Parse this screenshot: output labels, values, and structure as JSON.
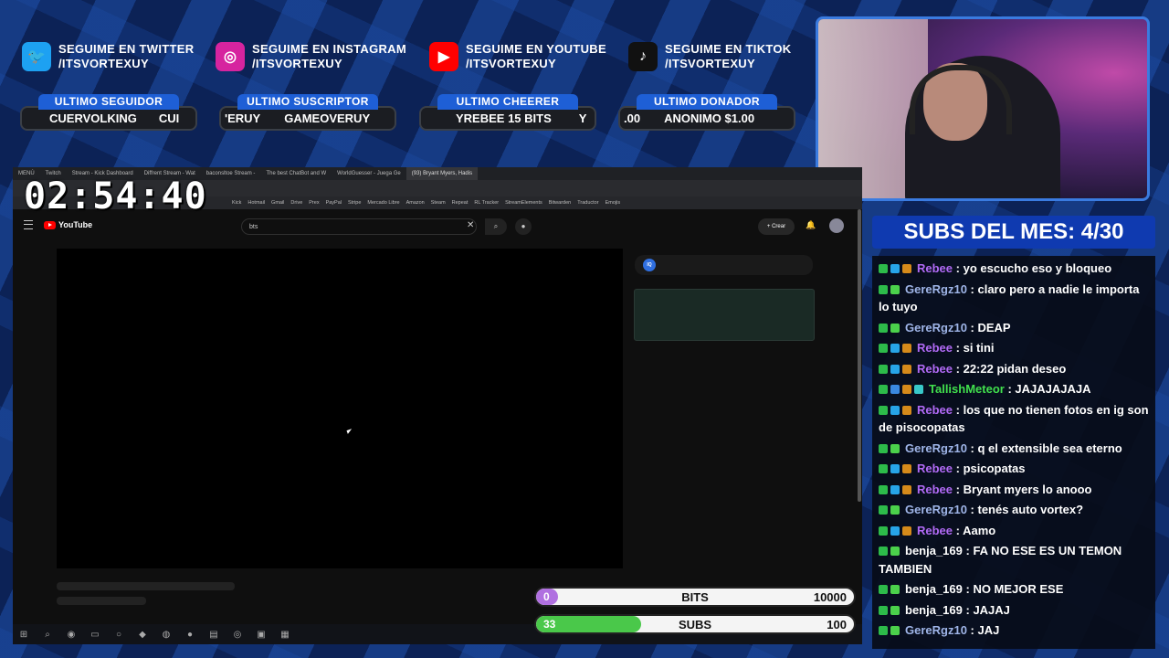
{
  "social": [
    {
      "platform": "twitter",
      "icon": "twitter-bird-icon",
      "line1": "SEGUIME EN TWITTER",
      "line2": "/ITSVORTEXUY",
      "color": "#1da1f2"
    },
    {
      "platform": "instagram",
      "icon": "instagram-icon",
      "line1": "SEGUIME EN INSTAGRAM",
      "line2": "/ITSVORTEXUY",
      "color": "#d6249f"
    },
    {
      "platform": "youtube",
      "icon": "youtube-play-icon",
      "line1": "SEGUIME EN YOUTUBE",
      "line2": "/ITSVORTEXUY",
      "color": "#ff0000"
    },
    {
      "platform": "tiktok",
      "icon": "tiktok-icon",
      "line1": "SEGUIME EN TIKTOK",
      "line2": "/ITSVORTEXUY",
      "color": "#111111"
    }
  ],
  "alerts": [
    {
      "header": "ULTIMO SEGUIDOR",
      "value": "CUERVOLKING",
      "next": "CUI"
    },
    {
      "header": "ULTIMO SUSCRIPTOR",
      "prev": "'ERUY",
      "value": "GAMEOVERUY"
    },
    {
      "header": "ULTIMO CHEERER",
      "value": "YREBEE 15 BITS",
      "next": "Y"
    },
    {
      "header": "ULTIMO DONADOR",
      "prev": ".00",
      "value": "ANONIMO $1.00"
    }
  ],
  "timer": "02:54:40",
  "browser": {
    "tabs": [
      "MENÚ",
      "Twitch",
      "Stream - Kick Dashboard",
      "Diffrent Stream - Wat",
      "baconsltoe Stream -",
      "The best ChatBot and W",
      "WorldGuesser - Juega Ge",
      "(93) Bryant Myers, Hadis"
    ],
    "active_tab_index": 7,
    "bookmarks": [
      "Kick",
      "Hotmail",
      "Gmail",
      "Drive",
      "Prex",
      "PayPal",
      "Stripe",
      "Mercado Libre",
      "Amazon",
      "Steam",
      "Repeat",
      "RL Tracker",
      "StreamElements",
      "Bitwarden",
      "Traductor",
      "Emojis"
    ],
    "youtube_logo": "YouTube",
    "search_query": "bts",
    "create_label": "+ Crear",
    "side_badge": "IQ"
  },
  "goals": [
    {
      "current": "0",
      "label": "BITS",
      "max": "10000",
      "progress": 0.04,
      "fill_color": "#b070e0"
    },
    {
      "current": "33",
      "label": "SUBS",
      "max": "100",
      "progress": 0.33,
      "fill_color": "#4ac84a"
    }
  ],
  "subs_title": "SUBS DEL MES: 4/30",
  "chat": [
    {
      "user": "Rebee",
      "user_color": "#b16af5",
      "text": "yo escucho eso y bloqueo",
      "badges": [
        "#2dbb4a",
        "#27a4e8",
        "#d68a1a"
      ]
    },
    {
      "user": "GereRgz10",
      "user_color": "#9fb5e8",
      "text": "claro pero a nadie le importa lo tuyo",
      "badges": [
        "#2dbb4a",
        "#4bd14b"
      ]
    },
    {
      "user": "GereRgz10",
      "user_color": "#9fb5e8",
      "text": "DEAP",
      "badges": [
        "#2dbb4a",
        "#4bd14b"
      ]
    },
    {
      "user": "Rebee",
      "user_color": "#b16af5",
      "text": "si tini",
      "badges": [
        "#2dbb4a",
        "#27a4e8",
        "#d68a1a"
      ]
    },
    {
      "user": "Rebee",
      "user_color": "#b16af5",
      "text": "22:22 pidan deseo",
      "badges": [
        "#2dbb4a",
        "#27a4e8",
        "#d68a1a"
      ]
    },
    {
      "user": "TallishMeteor",
      "user_color": "#41e04d",
      "text": "JAJAJAJAJA",
      "badges": [
        "#2dbb4a",
        "#3a88e0",
        "#d68a1a",
        "#38c8c8"
      ]
    },
    {
      "user": "Rebee",
      "user_color": "#b16af5",
      "text": "los que no tienen fotos en ig son de pisocopatas",
      "badges": [
        "#2dbb4a",
        "#27a4e8",
        "#d68a1a"
      ]
    },
    {
      "user": "GereRgz10",
      "user_color": "#9fb5e8",
      "text": "q el extensible sea eterno",
      "badges": [
        "#2dbb4a",
        "#4bd14b"
      ]
    },
    {
      "user": "Rebee",
      "user_color": "#b16af5",
      "text": "psicopatas",
      "badges": [
        "#2dbb4a",
        "#27a4e8",
        "#d68a1a"
      ]
    },
    {
      "user": "Rebee",
      "user_color": "#b16af5",
      "text": "Bryant myers lo anooo",
      "badges": [
        "#2dbb4a",
        "#27a4e8",
        "#d68a1a"
      ]
    },
    {
      "user": "GereRgz10",
      "user_color": "#9fb5e8",
      "text": "tenés auto vortex?",
      "badges": [
        "#2dbb4a",
        "#4bd14b"
      ]
    },
    {
      "user": "Rebee",
      "user_color": "#b16af5",
      "text": "Aamo",
      "badges": [
        "#2dbb4a",
        "#27a4e8",
        "#d68a1a"
      ]
    },
    {
      "user": "benja_169",
      "user_color": "#ffffff",
      "text": "FA NO ESE ES UN TEMON TAMBIEN",
      "badges": [
        "#2dbb4a",
        "#4bd14b"
      ]
    },
    {
      "user": "benja_169",
      "user_color": "#ffffff",
      "text": "NO MEJOR ESE",
      "badges": [
        "#2dbb4a",
        "#4bd14b"
      ]
    },
    {
      "user": "benja_169",
      "user_color": "#ffffff",
      "text": "JAJAJ",
      "badges": [
        "#2dbb4a",
        "#4bd14b"
      ]
    },
    {
      "user": "GereRgz10",
      "user_color": "#9fb5e8",
      "text": "JAJ",
      "badges": [
        "#2dbb4a",
        "#4bd14b"
      ]
    }
  ]
}
